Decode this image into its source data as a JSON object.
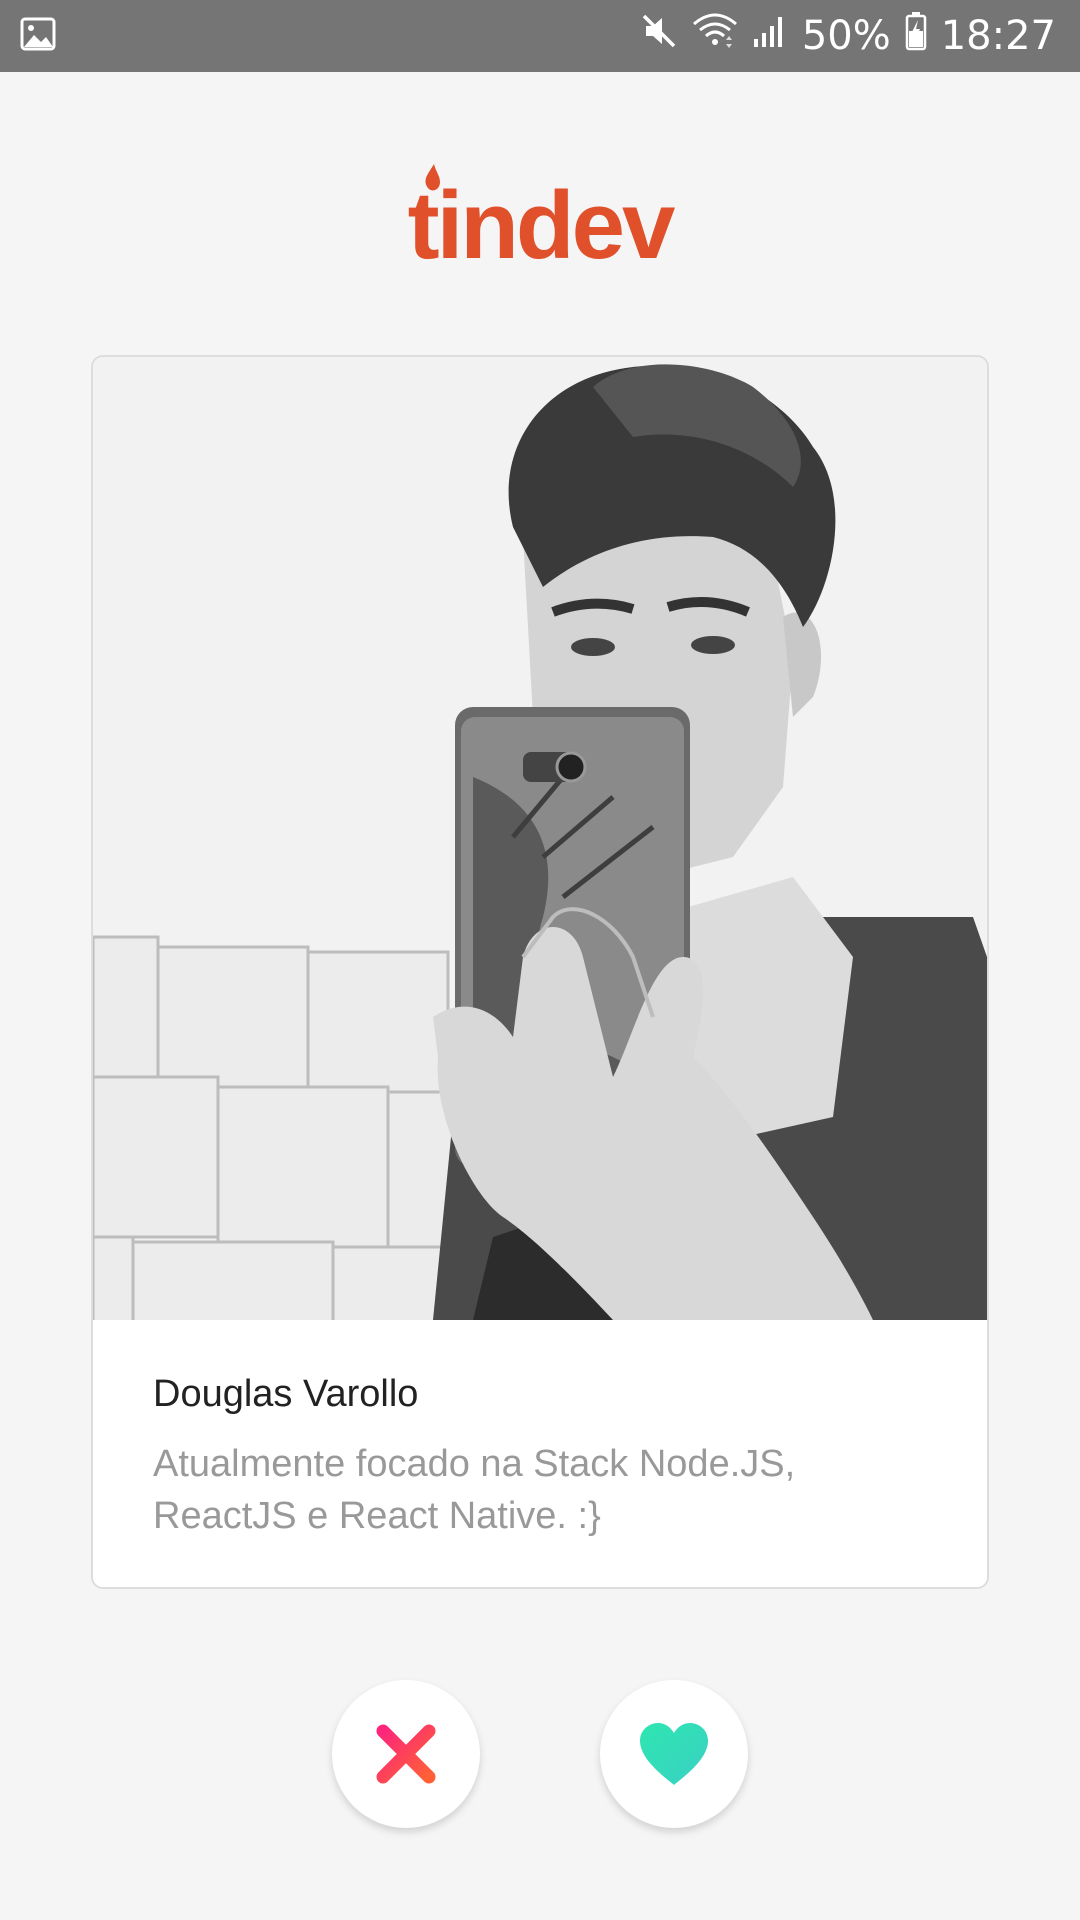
{
  "status_bar": {
    "battery_percent": "50%",
    "time": "18:27",
    "icons": [
      "gallery-notification-icon",
      "mute-icon",
      "wifi-icon",
      "signal-icon",
      "battery-charging-icon"
    ]
  },
  "header": {
    "logo_text": "tindev",
    "logo_color": "#e0502a"
  },
  "card": {
    "name": "Douglas Varollo",
    "bio": "Atualmente focado na Stack Node.JS, ReactJS e React Native. :}"
  },
  "actions": {
    "dislike_icon": "close-icon",
    "like_icon": "heart-icon",
    "dislike_color": "#fd5068",
    "like_color": "#3ed6b4"
  }
}
